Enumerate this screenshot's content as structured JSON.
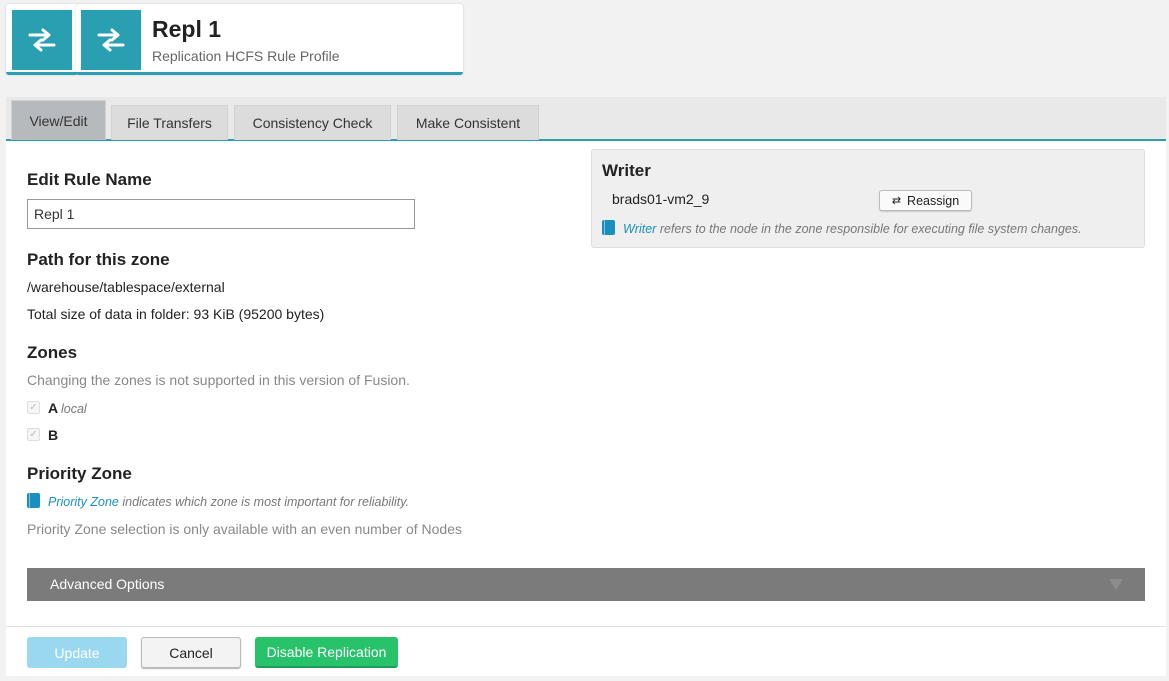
{
  "header": {
    "title": "Repl 1",
    "subtitle": "Replication HCFS Rule Profile",
    "icon": "swap-arrows-icon"
  },
  "tabs": [
    {
      "label": "View/Edit",
      "active": true
    },
    {
      "label": "File Transfers",
      "active": false
    },
    {
      "label": "Consistency Check",
      "active": false
    },
    {
      "label": "Make Consistent",
      "active": false
    }
  ],
  "rule_name": {
    "heading": "Edit Rule Name",
    "value": "Repl 1"
  },
  "path": {
    "heading": "Path for this zone",
    "value": "/warehouse/tablespace/external",
    "size_text": "Total size of data in folder: 93 KiB (95200 bytes)"
  },
  "zones": {
    "heading": "Zones",
    "note": "Changing the zones is not supported in this version of Fusion.",
    "items": [
      {
        "name": "A",
        "tag": "local",
        "checked": true
      },
      {
        "name": "B",
        "tag": "",
        "checked": true
      }
    ]
  },
  "priority": {
    "heading": "Priority Zone",
    "hint_link": "Priority Zone",
    "hint_text": "indicates which zone is most important for reliability.",
    "note": "Priority Zone selection is only available with an even number of Nodes"
  },
  "writer": {
    "heading": "Writer",
    "node": "brads01-vm2_9",
    "reassign_label": "Reassign",
    "hint_link": "Writer",
    "hint_text": "refers to the node in the zone responsible for executing file system changes."
  },
  "advanced": {
    "label": "Advanced Options"
  },
  "actions": {
    "update": "Update",
    "cancel": "Cancel",
    "disable": "Disable Replication"
  },
  "colors": {
    "accent": "#2a9fb2",
    "link": "#1a8fbf",
    "success": "#28c26a",
    "update_disabled": "#9ad8ef"
  }
}
